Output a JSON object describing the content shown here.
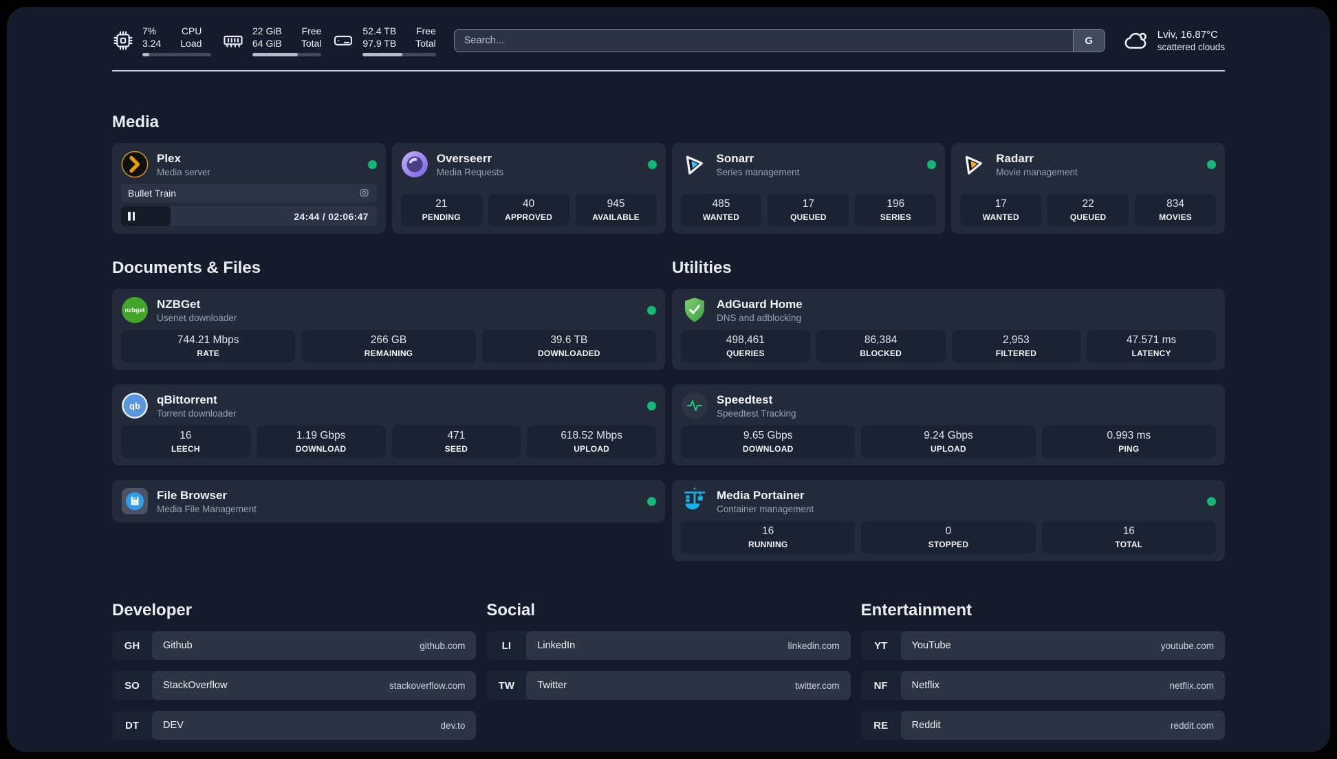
{
  "header": {
    "system_stats": [
      {
        "icon": "cpu-icon",
        "line1": "7%",
        "line2": "3.24",
        "label1": "CPU",
        "label2": "Load",
        "progress_pct": 10
      },
      {
        "icon": "memory-icon",
        "line1": "22 GiB",
        "line2": "64 GiB",
        "label1": "Free",
        "label2": "Total",
        "progress_pct": 66
      },
      {
        "icon": "disk-icon",
        "line1": "52.4 TB",
        "line2": "97.9 TB",
        "label1": "Free",
        "label2": "Total",
        "progress_pct": 54
      }
    ],
    "search": {
      "placeholder": "Search...",
      "engine_button": "G"
    },
    "weather": {
      "location": "Lviv, 16.87°C",
      "condition": "scattered clouds"
    }
  },
  "sections": {
    "media": {
      "title": "Media",
      "apps": [
        {
          "name": "Plex",
          "desc": "Media server",
          "online": true,
          "icon": "plex-icon",
          "player": {
            "title": "Bullet Train",
            "time": "24:44 / 02:06:47",
            "progress_pct": 19.5,
            "state": "paused"
          }
        },
        {
          "name": "Overseerr",
          "desc": "Media Requests",
          "online": true,
          "icon": "overseerr-icon",
          "stats": [
            {
              "value": "21",
              "label": "PENDING"
            },
            {
              "value": "40",
              "label": "APPROVED"
            },
            {
              "value": "945",
              "label": "AVAILABLE"
            }
          ]
        },
        {
          "name": "Sonarr",
          "desc": "Series management",
          "online": true,
          "icon": "sonarr-icon",
          "stats": [
            {
              "value": "485",
              "label": "WANTED"
            },
            {
              "value": "17",
              "label": "QUEUED"
            },
            {
              "value": "196",
              "label": "SERIES"
            }
          ]
        },
        {
          "name": "Radarr",
          "desc": "Movie management",
          "online": true,
          "icon": "radarr-icon",
          "stats": [
            {
              "value": "17",
              "label": "WANTED"
            },
            {
              "value": "22",
              "label": "QUEUED"
            },
            {
              "value": "834",
              "label": "MOVIES"
            }
          ]
        }
      ]
    },
    "documents": {
      "title": "Documents & Files",
      "apps": [
        {
          "name": "NZBGet",
          "desc": "Usenet downloader",
          "online": true,
          "icon": "nzbget-icon",
          "stats": [
            {
              "value": "744.21 Mbps",
              "label": "RATE"
            },
            {
              "value": "266 GB",
              "label": "REMAINING"
            },
            {
              "value": "39.6 TB",
              "label": "DOWNLOADED"
            }
          ]
        },
        {
          "name": "qBittorrent",
          "desc": "Torrent downloader",
          "online": true,
          "icon": "qbittorrent-icon",
          "stats": [
            {
              "value": "16",
              "label": "LEECH"
            },
            {
              "value": "1.19 Gbps",
              "label": "DOWNLOAD"
            },
            {
              "value": "471",
              "label": "SEED"
            },
            {
              "value": "618.52 Mbps",
              "label": "UPLOAD"
            }
          ]
        },
        {
          "name": "File Browser",
          "desc": "Media File Management",
          "online": true,
          "icon": "filebrowser-icon"
        }
      ]
    },
    "utilities": {
      "title": "Utilities",
      "apps": [
        {
          "name": "AdGuard Home",
          "desc": "DNS and adblocking",
          "online": false,
          "icon": "adguard-icon",
          "stats": [
            {
              "value": "498,461",
              "label": "QUERIES"
            },
            {
              "value": "86,384",
              "label": "BLOCKED"
            },
            {
              "value": "2,953",
              "label": "FILTERED"
            },
            {
              "value": "47.571 ms",
              "label": "LATENCY"
            }
          ]
        },
        {
          "name": "Speedtest",
          "desc": "Speedtest Tracking",
          "online": false,
          "icon": "speedtest-icon",
          "stats": [
            {
              "value": "9.65 Gbps",
              "label": "DOWNLOAD"
            },
            {
              "value": "9.24 Gbps",
              "label": "UPLOAD"
            },
            {
              "value": "0.993 ms",
              "label": "PING"
            }
          ]
        },
        {
          "name": "Media Portainer",
          "desc": "Container management",
          "online": true,
          "icon": "portainer-icon",
          "stats": [
            {
              "value": "16",
              "label": "RUNNING"
            },
            {
              "value": "0",
              "label": "STOPPED"
            },
            {
              "value": "16",
              "label": "TOTAL"
            }
          ]
        }
      ]
    }
  },
  "link_sections": [
    {
      "title": "Developer",
      "items": [
        {
          "abbr": "GH",
          "name": "Github",
          "url": "github.com"
        },
        {
          "abbr": "SO",
          "name": "StackOverflow",
          "url": "stackoverflow.com"
        },
        {
          "abbr": "DT",
          "name": "DEV",
          "url": "dev.to"
        }
      ]
    },
    {
      "title": "Social",
      "items": [
        {
          "abbr": "LI",
          "name": "LinkedIn",
          "url": "linkedin.com"
        },
        {
          "abbr": "TW",
          "name": "Twitter",
          "url": "twitter.com"
        }
      ]
    },
    {
      "title": "Entertainment",
      "items": [
        {
          "abbr": "YT",
          "name": "YouTube",
          "url": "youtube.com"
        },
        {
          "abbr": "NF",
          "name": "Netflix",
          "url": "netflix.com"
        },
        {
          "abbr": "RE",
          "name": "Reddit",
          "url": "reddit.com"
        }
      ]
    }
  ],
  "colors": {
    "status_online": "#17b877",
    "background": "#151b2b",
    "card": "#232b3a",
    "stat_box": "#1b2232",
    "plex_gold": "#e5a00d",
    "sonarr_blue": "#36c3f2",
    "radarr_orange": "#f7a827",
    "portainer_blue": "#15b2e5"
  }
}
